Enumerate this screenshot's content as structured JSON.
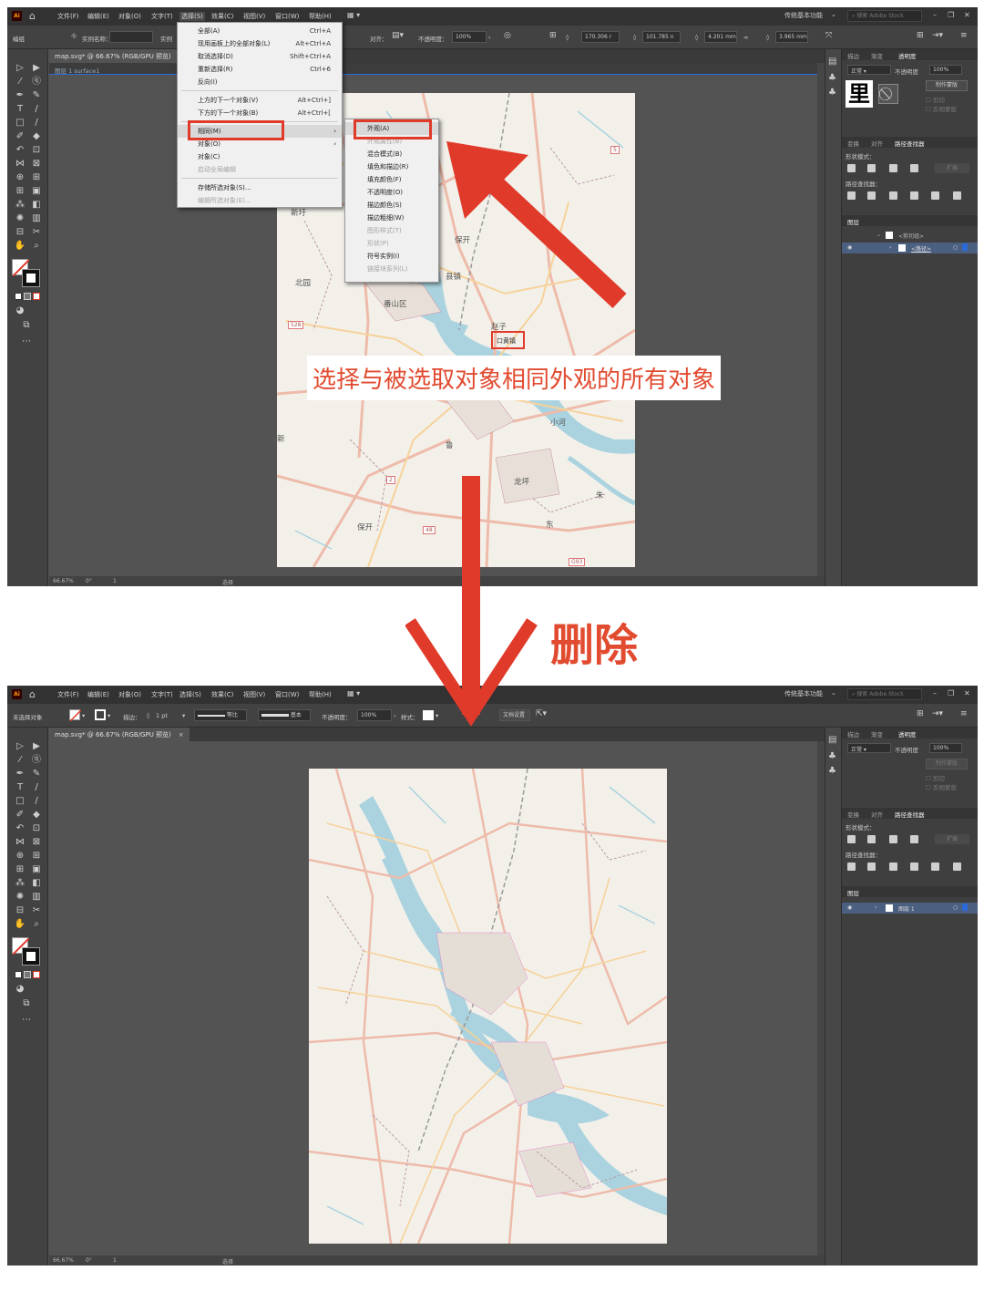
{
  "app": {
    "logo": "Ai",
    "menu": [
      "文件(F)",
      "编辑(E)",
      "对象(O)",
      "文字(T)",
      "选择(S)",
      "效果(C)",
      "视图(V)",
      "窗口(W)",
      "帮助(H)"
    ],
    "workspace": "传统基本功能",
    "search_placeholder": "搜索 Adobe Stock"
  },
  "screen1": {
    "control": {
      "no_selection": "编组",
      "layer_label": "实例名称：",
      "layer_label2": "实例",
      "align": "对齐：",
      "opacity_label": "不透明度：",
      "opacity": "100%",
      "w": "170.306 r",
      "x": "101.785 n",
      "h": "4.201 mm",
      "y": "3.965 mm"
    },
    "tab": {
      "label": "map.svg* @ 66.67% (RGB/GPU 预览)",
      "close": "×"
    },
    "breadcrumb": "图层 1   surface1",
    "status": {
      "zoom": "66.67%",
      "angle": "0°",
      "page": "1",
      "tool": "选择"
    },
    "select_menu": [
      {
        "label": "全部(A)",
        "shortcut": "Ctrl+A",
        "disabled": false
      },
      {
        "label": "现用画板上的全部对象(L)",
        "shortcut": "Alt+Ctrl+A",
        "disabled": false
      },
      {
        "label": "取消选择(D)",
        "shortcut": "Shift+Ctrl+A",
        "disabled": false
      },
      {
        "label": "重新选择(R)",
        "shortcut": "Ctrl+6",
        "disabled": false
      },
      {
        "label": "反向(I)",
        "shortcut": "",
        "disabled": false
      },
      {
        "label": "上方的下一个对象(V)",
        "shortcut": "Alt+Ctrl+]",
        "disabled": false
      },
      {
        "label": "下方的下一个对象(B)",
        "shortcut": "Alt+Ctrl+[",
        "disabled": false
      },
      {
        "label": "相同(M)",
        "shortcut": "",
        "disabled": false,
        "submenu": true
      },
      {
        "label": "对象(O)",
        "shortcut": "",
        "disabled": false,
        "submenu": true
      },
      {
        "label": "对象(C)",
        "shortcut": "",
        "disabled": false
      },
      {
        "label": "启动全局编辑",
        "shortcut": "",
        "disabled": true
      },
      {
        "label": "存储所选对象(S)...",
        "shortcut": "",
        "disabled": false
      },
      {
        "label": "编辑所选对象(E)...",
        "shortcut": "",
        "disabled": true
      }
    ],
    "same_submenu": [
      {
        "label": "外观(A)",
        "disabled": false
      },
      {
        "label": "外观属性(B)",
        "disabled": true
      },
      {
        "label": "混合模式(B)",
        "disabled": false
      },
      {
        "label": "填色和描边(R)",
        "disabled": false
      },
      {
        "label": "填充颜色(F)",
        "disabled": false
      },
      {
        "label": "不透明度(O)",
        "disabled": false
      },
      {
        "label": "描边颜色(S)",
        "disabled": false
      },
      {
        "label": "描边粗细(W)",
        "disabled": false
      },
      {
        "label": "图形样式(T)",
        "disabled": true
      },
      {
        "label": "形状(P)",
        "disabled": true
      },
      {
        "label": "符号实例(I)",
        "disabled": false
      },
      {
        "label": "链接块系列(L)",
        "disabled": true
      }
    ],
    "panel": {
      "tabs": [
        "描边",
        "渐变",
        "透明度"
      ],
      "blend": "正常",
      "opacity_label": "不透明度",
      "opacity": "100%",
      "make_mask": "制作蒙版",
      "clip": "剪切",
      "invert": "反相蒙版",
      "tabs2": [
        "变换",
        "对齐",
        "路径查找器"
      ],
      "shape_modes": "形状模式：",
      "expand": "扩展",
      "pathfinders": "路径查找器：",
      "layers_tab": "图层",
      "layers": [
        "<剪切组>",
        "<路径>"
      ]
    },
    "map_labels": [
      "坑仔",
      "新圩",
      "北园",
      "番山区",
      "赵子",
      "新",
      "龙坪",
      "保开",
      "县镇",
      "小河",
      "朱",
      "鲁",
      "东"
    ],
    "highlight_label": "口黄镇",
    "road_nums": [
      "528",
      "48",
      "6",
      "G93",
      "5",
      "2",
      "1"
    ],
    "caption": "选择与被选取对象相同外观的所有对象"
  },
  "arrow_label": "删除",
  "screen2": {
    "control": {
      "no_selection": "未选择对象",
      "stroke_label": "描边：",
      "stroke_val": "1 pt",
      "brush1": "等比",
      "brush2": "基本",
      "opacity_label": "不透明度：",
      "opacity": "100%",
      "style_label": "样式：",
      "doc_setup": "文档设置",
      "prefs": "首选项"
    },
    "tab": {
      "label": "map.svg* @ 66.67% (RGB/GPU 预览)",
      "close": "×"
    },
    "status": {
      "zoom": "66.67%",
      "angle": "0°",
      "page": "1",
      "tool": "选择"
    },
    "panel": {
      "tabs": [
        "描边",
        "渐变",
        "透明度"
      ],
      "blend": "正常",
      "opacity_label": "不透明度",
      "opacity": "100%",
      "make_mask": "制作蒙版",
      "clip": "剪切",
      "invert": "反相蒙版",
      "tabs2": [
        "变换",
        "对齐",
        "路径查找器"
      ],
      "shape_modes": "形状模式：",
      "expand": "扩展",
      "pathfinders": "路径查找器：",
      "layers_tab": "图层",
      "layers": [
        "图层 1"
      ]
    }
  },
  "colors": {
    "accent_red": "#e03a2a",
    "caption_red": "#e14b30",
    "ui_dark": "#535353",
    "river": "#aad3df"
  }
}
